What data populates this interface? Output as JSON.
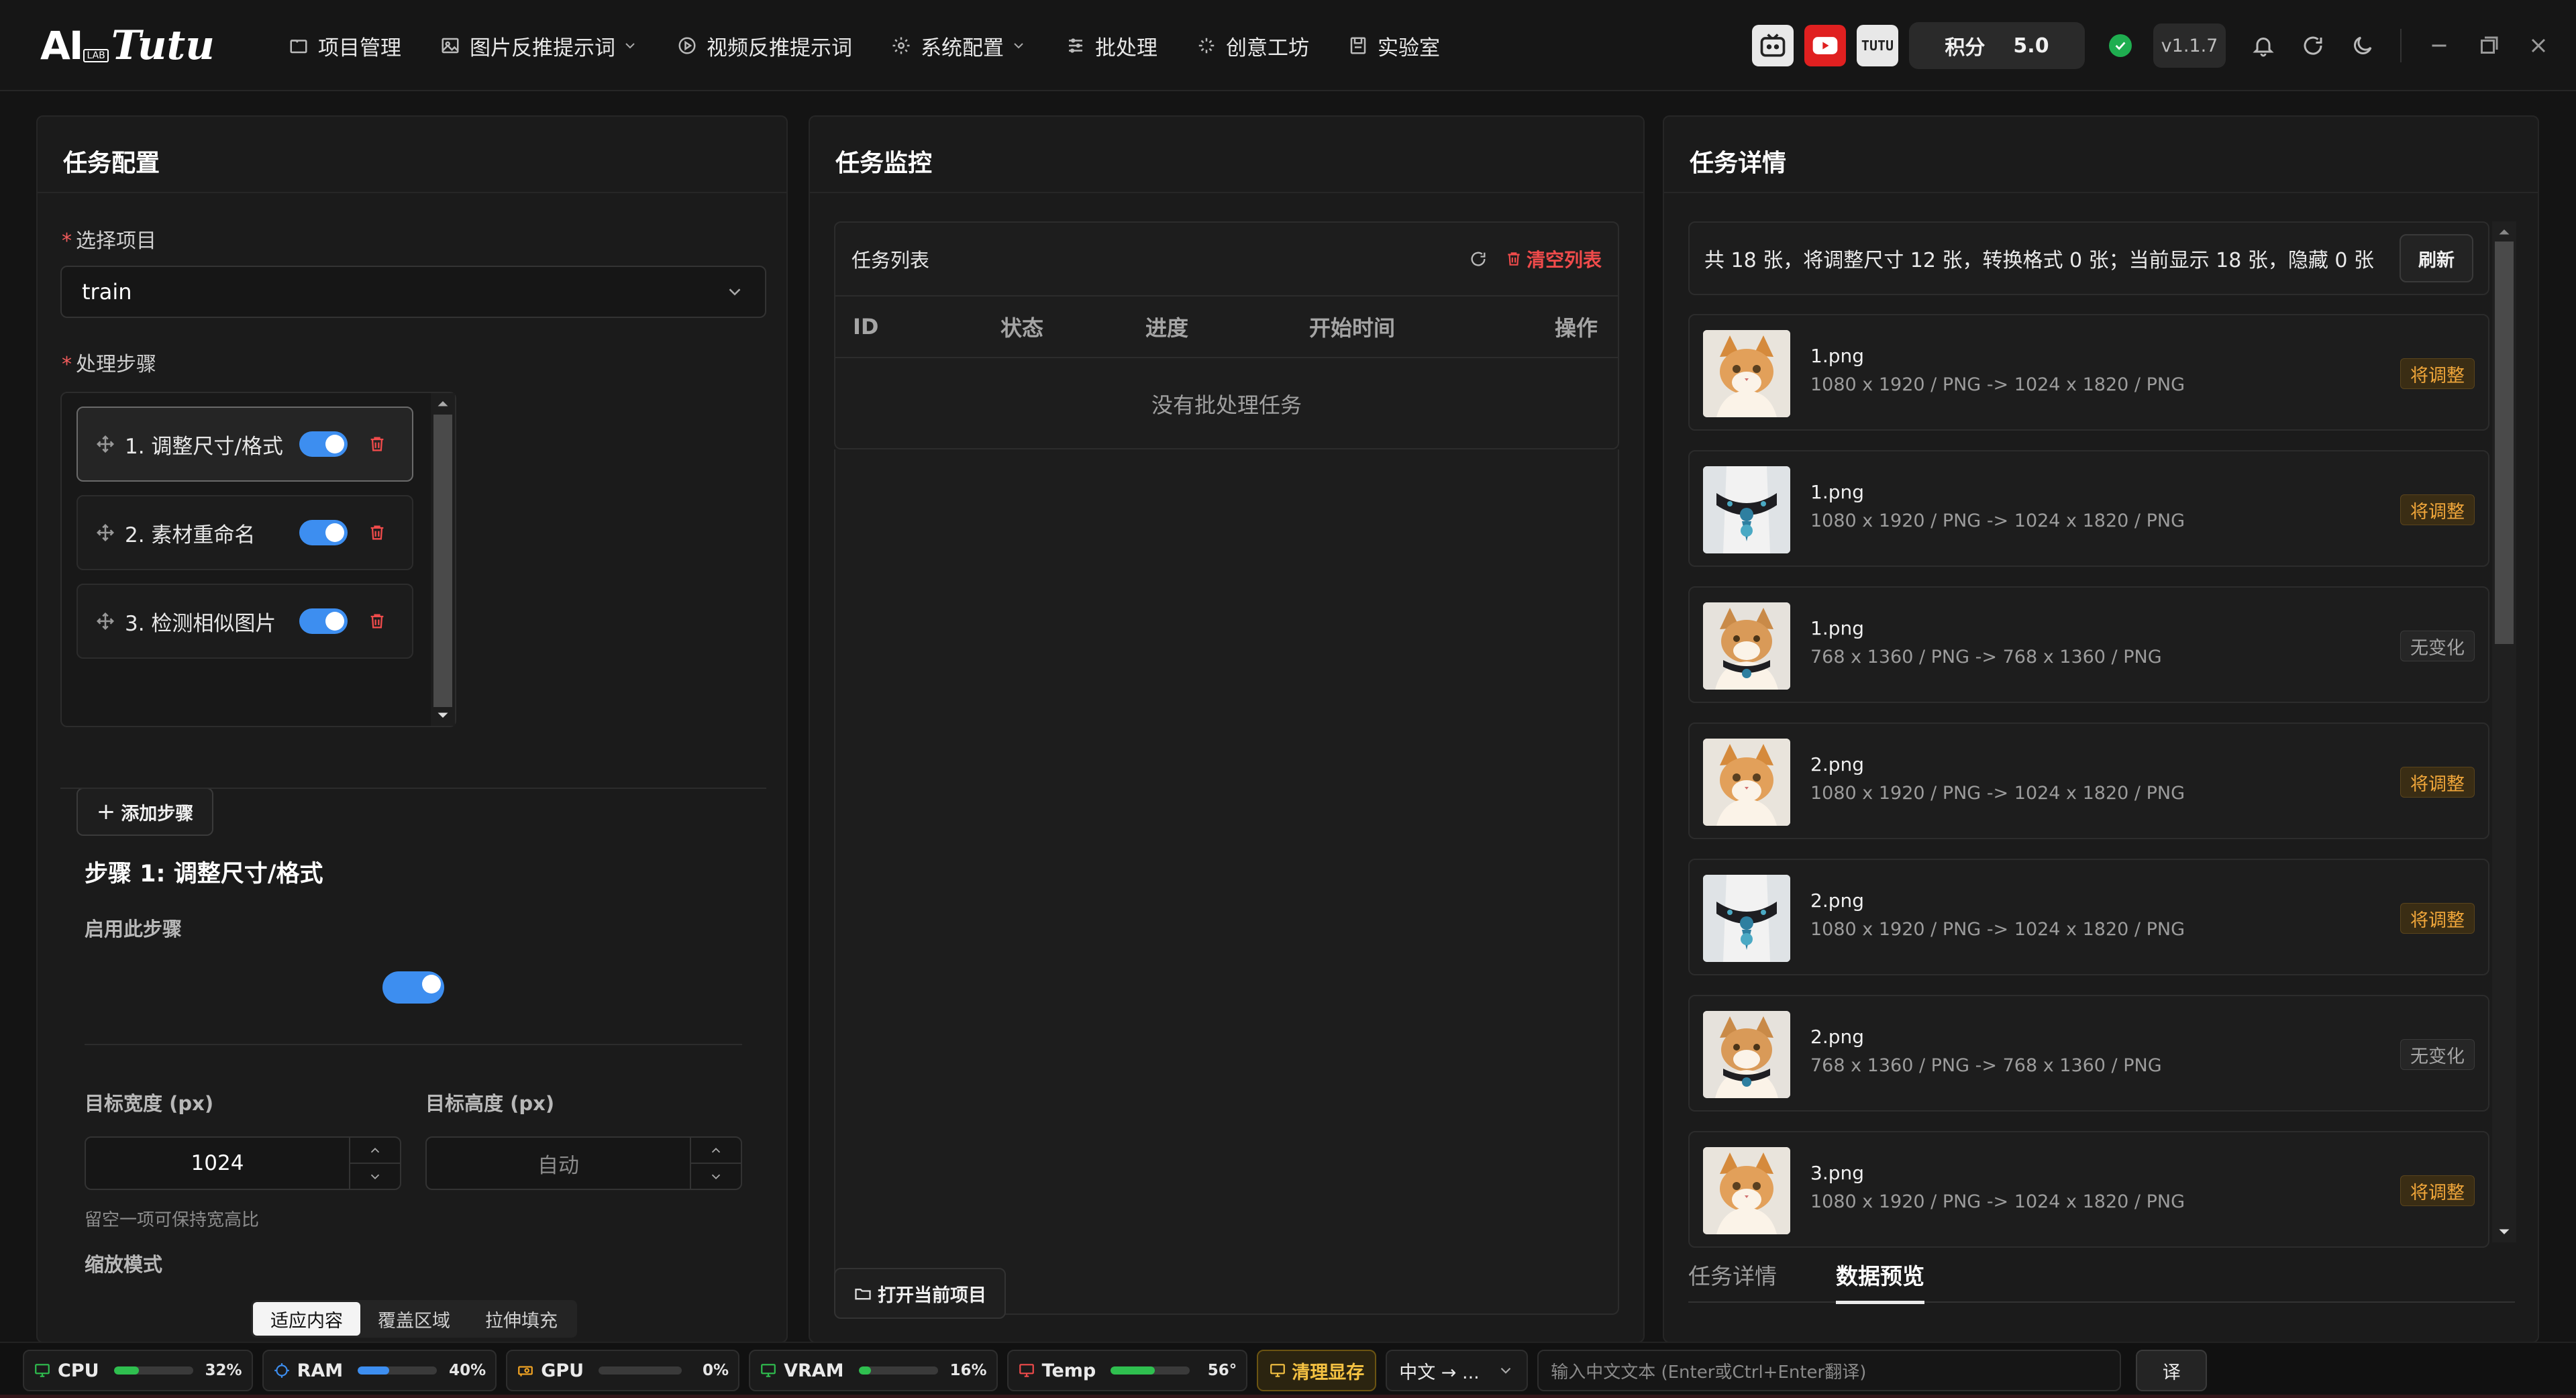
{
  "app": {
    "logo_main": "AI",
    "logo_lab": "LAB",
    "logo_script": "Tutu"
  },
  "nav": [
    {
      "label": "项目管理",
      "icon": "folder-icon"
    },
    {
      "label": "图片反推提示词",
      "icon": "image-icon",
      "dropdown": true
    },
    {
      "label": "视频反推提示词",
      "icon": "play-icon"
    },
    {
      "label": "系统配置",
      "icon": "gear-icon",
      "dropdown": true
    },
    {
      "label": "批处理",
      "icon": "sliders-icon"
    },
    {
      "label": "创意工坊",
      "icon": "sparkle-icon"
    },
    {
      "label": "实验室",
      "icon": "flask-icon"
    }
  ],
  "header": {
    "tutu_badge": "TUTU",
    "score_label": "积分",
    "score_value": "5.0",
    "version": "v1.1.7"
  },
  "config": {
    "title": "任务配置",
    "project_label": "选择项目",
    "project_value": "train",
    "steps_label": "处理步骤",
    "steps": [
      {
        "label": "1. 调整尺寸/格式",
        "enabled": true
      },
      {
        "label": "2. 素材重命名",
        "enabled": true
      },
      {
        "label": "3. 检测相似图片",
        "enabled": true
      }
    ],
    "add_step": "添加步骤",
    "step_detail_title": "步骤 1: 调整尺寸/格式",
    "enable_label": "启用此步骤",
    "width_label": "目标宽度 (px)",
    "width_value": "1024",
    "height_label": "目标高度 (px)",
    "height_placeholder": "自动",
    "ratio_hint": "留空一项可保持宽高比",
    "scale_mode_label": "缩放模式",
    "scale_modes": [
      "适应内容",
      "覆盖区域",
      "拉伸填充"
    ],
    "scale_mode_selected": "适应内容"
  },
  "monitor": {
    "title": "任务监控",
    "list_title": "任务列表",
    "clear_label": "清空列表",
    "columns": [
      "ID",
      "状态",
      "进度",
      "开始时间",
      "操作"
    ],
    "empty": "没有批处理任务",
    "open_project": "打开当前项目"
  },
  "detail": {
    "title": "任务详情",
    "summary": "共 18 张，将调整尺寸 12 张，转换格式 0 张；当前显示 18 张，隐藏 0 张",
    "refresh": "刷新",
    "images": [
      {
        "name": "1.png",
        "meta": "1080 x 1920 / PNG -> 1024 x 1820 / PNG",
        "status": "将调整",
        "kind": "adj",
        "art": "cat"
      },
      {
        "name": "1.png",
        "meta": "1080 x 1920 / PNG -> 1024 x 1820 / PNG",
        "status": "将调整",
        "kind": "adj",
        "art": "collar"
      },
      {
        "name": "1.png",
        "meta": "768 x 1360 / PNG -> 768 x 1360 / PNG",
        "status": "无变化",
        "kind": "none",
        "art": "catcollar"
      },
      {
        "name": "2.png",
        "meta": "1080 x 1920 / PNG -> 1024 x 1820 / PNG",
        "status": "将调整",
        "kind": "adj",
        "art": "cat"
      },
      {
        "name": "2.png",
        "meta": "1080 x 1920 / PNG -> 1024 x 1820 / PNG",
        "status": "将调整",
        "kind": "adj",
        "art": "collar"
      },
      {
        "name": "2.png",
        "meta": "768 x 1360 / PNG -> 768 x 1360 / PNG",
        "status": "无变化",
        "kind": "none",
        "art": "catcollar"
      },
      {
        "name": "3.png",
        "meta": "1080 x 1920 / PNG -> 1024 x 1820 / PNG",
        "status": "将调整",
        "kind": "adj",
        "art": "cat"
      }
    ],
    "tabs": [
      "任务详情",
      "数据预览"
    ],
    "tab_selected": "数据预览"
  },
  "status": {
    "items": [
      {
        "label": "CPU",
        "percent": 32,
        "pct_text": "32%",
        "color": "#2fbf4f",
        "icon": "monitor-icon"
      },
      {
        "label": "RAM",
        "percent": 40,
        "pct_text": "40%",
        "color": "#3d8ef0",
        "icon": "chip-icon"
      },
      {
        "label": "GPU",
        "percent": 0,
        "pct_text": "0%",
        "color": "#f5a623",
        "icon": "gpu-icon"
      },
      {
        "label": "VRAM",
        "percent": 16,
        "pct_text": "16%",
        "color": "#2fbf4f",
        "icon": "monitor-icon"
      },
      {
        "label": "Temp",
        "percent": 56,
        "pct_text": "56°",
        "color": "#2fbf4f",
        "icon": "thermo-icon"
      }
    ],
    "clear_vram": "清理显存",
    "lang": "中文 → ...",
    "translate_placeholder": "输入中文文本 (Enter或Ctrl+Enter翻译)",
    "translate_btn": "译"
  },
  "colors": {
    "accent": "#3d8ef0",
    "danger": "#f04b4b",
    "warn": "#f0a63a",
    "ok": "#1fae50"
  }
}
